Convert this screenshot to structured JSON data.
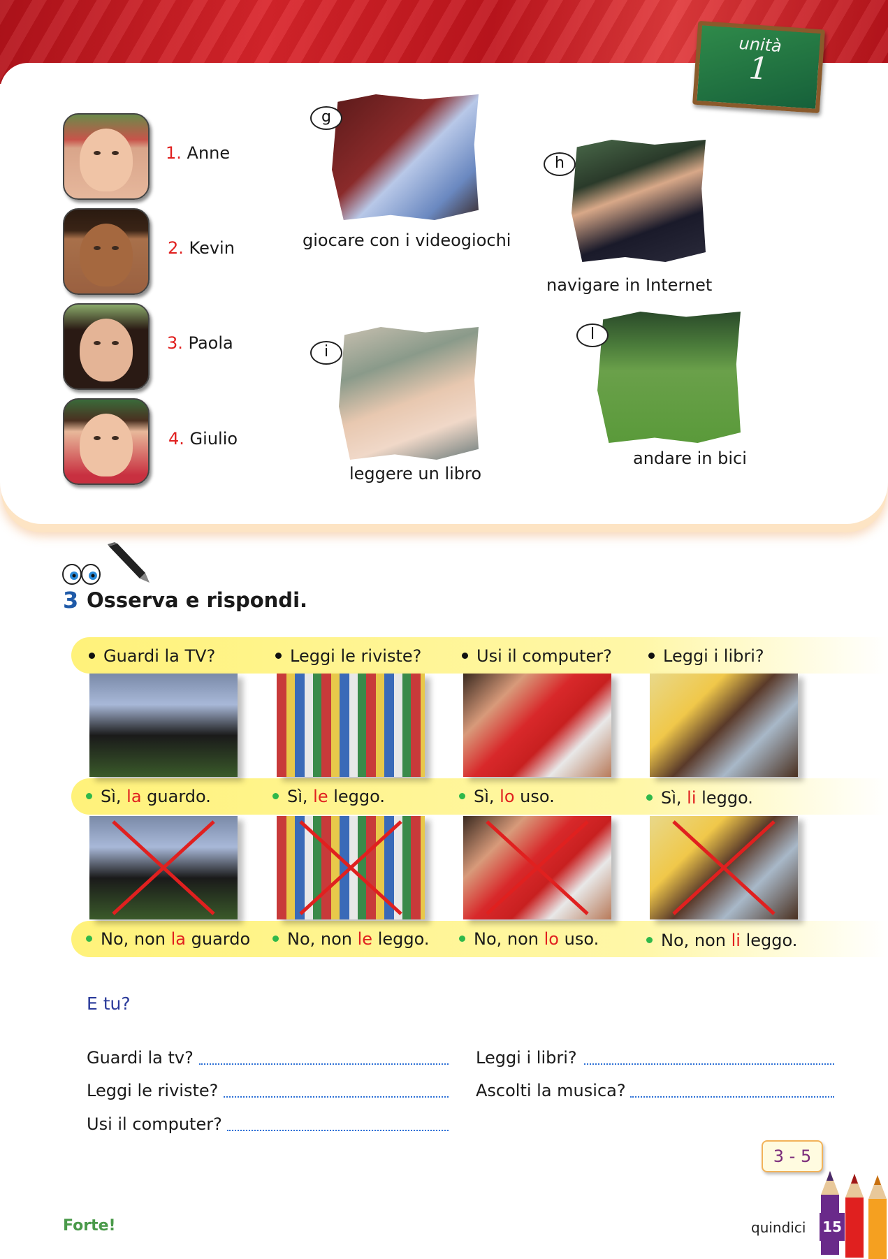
{
  "header": {
    "unit_word": "unità",
    "unit_number": "1"
  },
  "kids": [
    {
      "num": "1.",
      "name": "Anne"
    },
    {
      "num": "2.",
      "name": "Kevin"
    },
    {
      "num": "3.",
      "name": "Paola"
    },
    {
      "num": "4.",
      "name": "Giulio"
    }
  ],
  "activities": [
    {
      "letter": "g",
      "caption": "giocare con i videogiochi"
    },
    {
      "letter": "h",
      "caption": "navigare in Internet"
    },
    {
      "letter": "i",
      "caption": "leggere un libro"
    },
    {
      "letter": "l",
      "caption": "andare in bici"
    }
  ],
  "exercise": {
    "number": "3",
    "title": "Osserva e rispondi.",
    "columns": [
      {
        "question": "Guardi la TV?",
        "yes_a": "Sì, ",
        "yes_pron": "la",
        "yes_b": " guardo.",
        "no_a": "No, non ",
        "no_pron": "la",
        "no_b": " guardo"
      },
      {
        "question": "Leggi le riviste?",
        "yes_a": "Sì, ",
        "yes_pron": "le",
        "yes_b": " leggo.",
        "no_a": "No, non ",
        "no_pron": "le",
        "no_b": " leggo."
      },
      {
        "question": "Usi il computer?",
        "yes_a": "Sì, ",
        "yes_pron": "lo",
        "yes_b": " uso.",
        "no_a": "No, non ",
        "no_pron": "lo",
        "no_b": " uso."
      },
      {
        "question": "Leggi i libri?",
        "yes_a": "Sì, ",
        "yes_pron": "li",
        "yes_b": " leggo.",
        "no_a": "No, non ",
        "no_pron": "li",
        "no_b": " leggo."
      }
    ]
  },
  "etu": {
    "heading": "E tu?",
    "questions": [
      "Guardi la tv?",
      "Leggi le riviste?",
      "Usi il computer?",
      "Leggi i libri?",
      "Ascolti la musica?"
    ]
  },
  "badge": "3 - 5",
  "footer": {
    "brand": "Forte!",
    "page_word": "quindici",
    "page_number": "15"
  },
  "colors": {
    "accent_red": "#e0201f",
    "exercise_blue": "#1f5aa8",
    "highlight_yellow": "#fff27a",
    "page_purple": "#6a2a8a"
  }
}
